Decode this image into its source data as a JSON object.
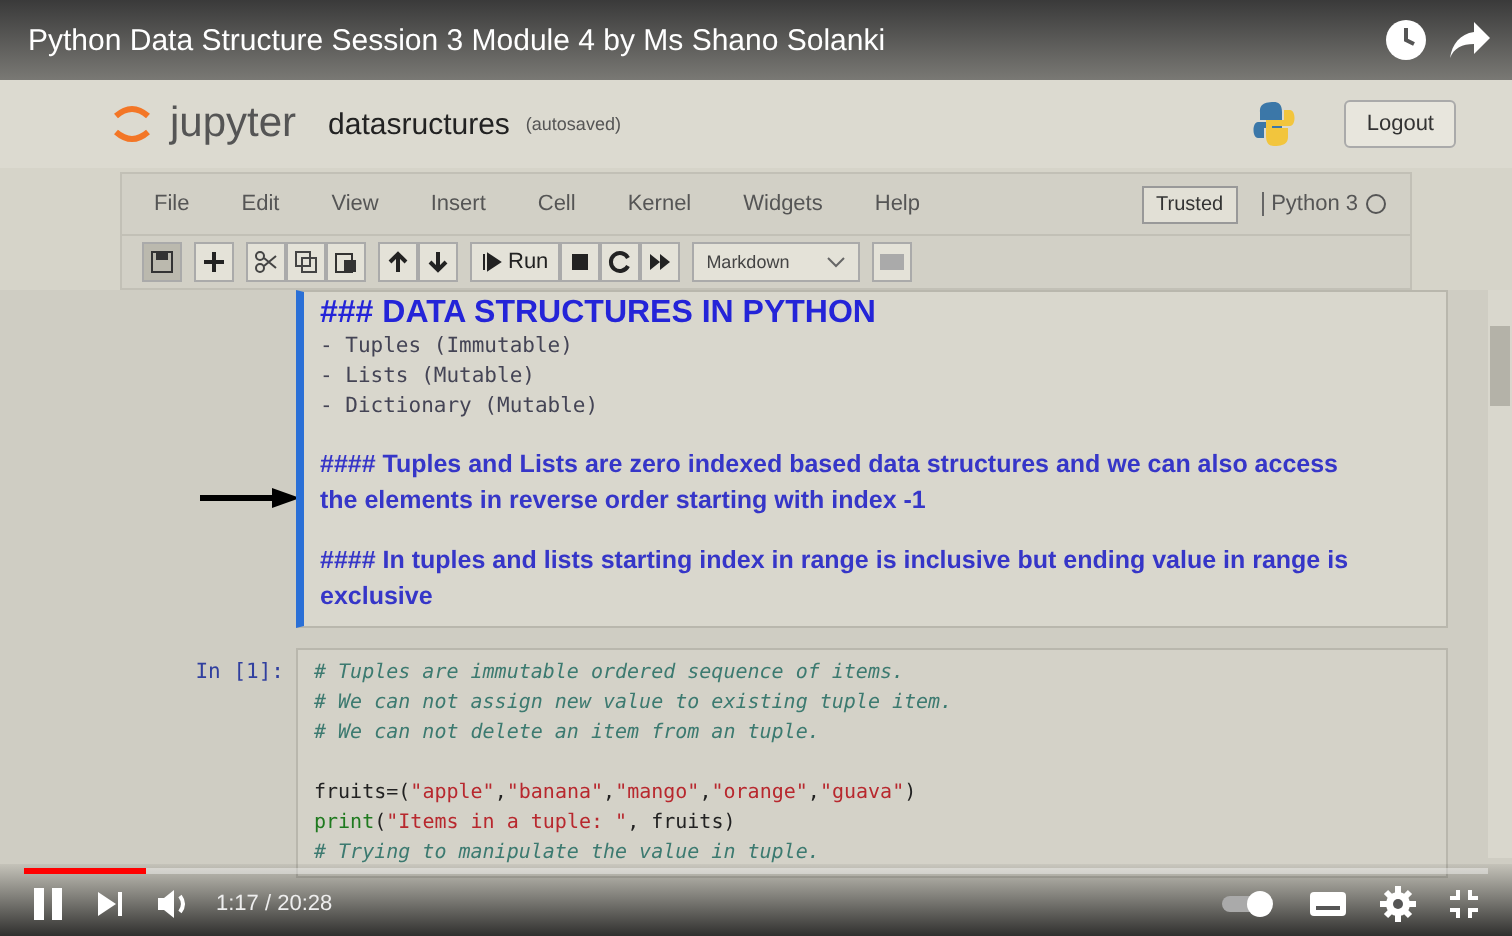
{
  "video": {
    "title": "Python Data Structure Session 3 Module 4 by Ms Shano Solanki",
    "time": "1:17 / 20:28",
    "progress": {
      "level": 0.083
    },
    "playing": true
  },
  "notebook": {
    "logo_text": "jupyter",
    "name": "datasructures",
    "save_status": "(autosaved)",
    "logout": "Logout",
    "menus": [
      "File",
      "Edit",
      "View",
      "Insert",
      "Cell",
      "Kernel",
      "Widgets",
      "Help"
    ],
    "trusted": "Trusted",
    "kernel": "Python 3",
    "run_label": "Run",
    "cell_type": "Markdown",
    "markdown_cell": {
      "selected": true,
      "pointer_arrow": true,
      "heading": "### DATA STRUCTURES IN PYTHON",
      "list": [
        "- Tuples (Immutable)",
        "- Lists (Mutable)",
        "- Dictionary (Mutable)"
      ],
      "paragraphs": [
        {
          "text": "#### Tuples and Lists are zero indexed based data structures and we can also access the elements in reverse order starting with index -1"
        },
        {
          "text": "#### In tuples and lists starting index in range is inclusive but ending value in range is exclusive"
        }
      ]
    },
    "code_cell": {
      "prompt": "In [1]:",
      "blocks": [
        [
          {
            "tokens": [
              {
                "kind": "comment",
                "text": "# Tuples are immutable ordered sequence of items."
              }
            ]
          },
          {
            "tokens": [
              {
                "kind": "comment",
                "text": "# We can not assign new value to existing tuple item."
              }
            ]
          },
          {
            "tokens": [
              {
                "kind": "comment",
                "text": "# We can not delete an item from an tuple."
              }
            ]
          }
        ],
        [
          {
            "tokens": [
              {
                "kind": "plain",
                "text": "fruits=("
              },
              {
                "kind": "string",
                "text": "\"apple\""
              },
              {
                "kind": "plain",
                "text": ","
              },
              {
                "kind": "string",
                "text": "\"banana\""
              },
              {
                "kind": "plain",
                "text": ","
              },
              {
                "kind": "string",
                "text": "\"mango\""
              },
              {
                "kind": "plain",
                "text": ","
              },
              {
                "kind": "string",
                "text": "\"orange\""
              },
              {
                "kind": "plain",
                "text": ","
              },
              {
                "kind": "string",
                "text": "\"guava\""
              },
              {
                "kind": "plain",
                "text": ")"
              }
            ]
          },
          {
            "tokens": [
              {
                "kind": "builtin",
                "text": "print"
              },
              {
                "kind": "plain",
                "text": "("
              },
              {
                "kind": "string",
                "text": "\"Items in a tuple: \""
              },
              {
                "kind": "plain",
                "text": ", fruits)"
              }
            ]
          },
          {
            "tokens": [
              {
                "kind": "comment",
                "text": "# Trying to manipulate the value in tuple."
              }
            ]
          }
        ]
      ]
    }
  }
}
